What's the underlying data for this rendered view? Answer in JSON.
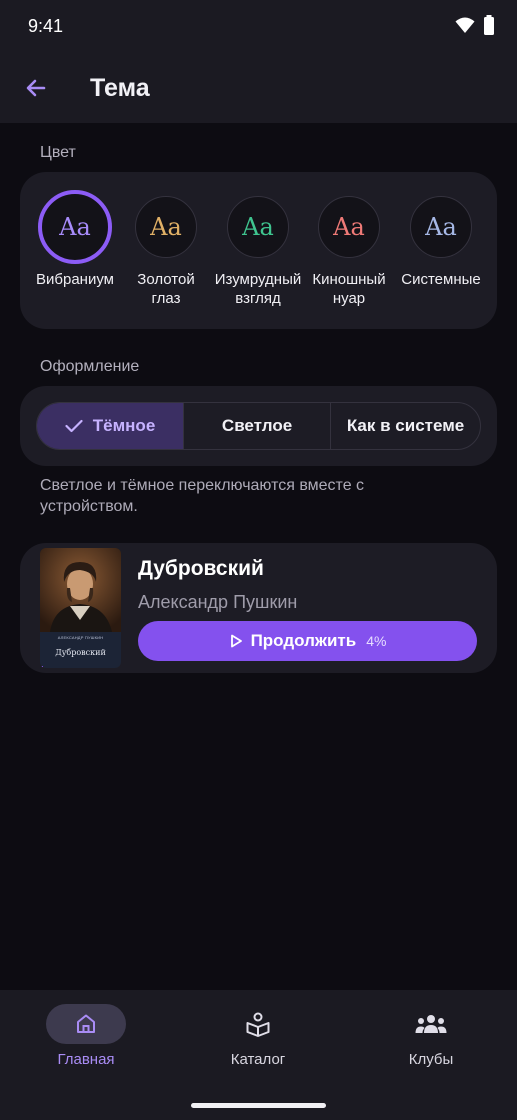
{
  "status_bar": {
    "time": "9:41"
  },
  "app_bar": {
    "title": "Тема"
  },
  "color_section": {
    "label": "Цвет",
    "swatches": [
      {
        "label": "Вибраниум",
        "glyph": "Aa",
        "color": "#a78bfa",
        "selected": true
      },
      {
        "label": "Золотой\nглаз",
        "glyph": "Aa",
        "color": "#e0b066",
        "selected": false
      },
      {
        "label": "Изумрудный\nвзгляд",
        "glyph": "Aa",
        "color": "#3fc48f",
        "selected": false
      },
      {
        "label": "Киношный\nнуар",
        "glyph": "Aa",
        "color": "#ef7a77",
        "selected": false
      },
      {
        "label": "Системные",
        "glyph": "Aa",
        "color": "#a6b8e6",
        "selected": false
      }
    ]
  },
  "appearance_section": {
    "label": "Оформление",
    "options": [
      {
        "label": "Тёмное",
        "active": true
      },
      {
        "label": "Светлое",
        "active": false
      },
      {
        "label": "Как в системе",
        "active": false
      }
    ],
    "hint": "Светлое и тёмное переключаются вместе с устройством."
  },
  "book": {
    "title": "Дубровский",
    "author": "Александр Пушкин",
    "cover_author": "АЛЕКСАНДР ПУШКИН",
    "cover_title": "Дубровский",
    "continue_label": "Продолжить",
    "progress_text": "4%",
    "progress_fraction": 0.04
  },
  "bottom_nav": {
    "items": [
      {
        "label": "Главная",
        "icon": "home-icon",
        "active": true
      },
      {
        "label": "Каталог",
        "icon": "catalog-icon",
        "active": false
      },
      {
        "label": "Клубы",
        "icon": "clubs-icon",
        "active": false
      }
    ]
  },
  "colors": {
    "accent": "#8451ee",
    "background": "#0d0c12",
    "surface": "#1d1c25"
  }
}
